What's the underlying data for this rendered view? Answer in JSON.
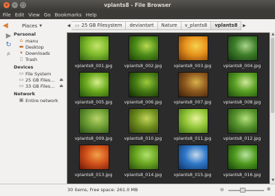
{
  "window": {
    "title": "vplants8 - File Browser",
    "close_icon": "×",
    "min_icon": "–",
    "max_icon": "□"
  },
  "menu": [
    "File",
    "Edit",
    "View",
    "Go",
    "Bookmarks",
    "Help"
  ],
  "places": {
    "label": "Places",
    "chevron": "▼"
  },
  "sidebar": {
    "personal": {
      "heading": "Personal",
      "items": [
        {
          "label": "manu",
          "icon": "home-icon"
        },
        {
          "label": "Desktop",
          "icon": "desktop-icon"
        },
        {
          "label": "Downloads",
          "icon": "downloads-icon"
        },
        {
          "label": "Trash",
          "icon": "trash-icon"
        }
      ]
    },
    "devices": {
      "heading": "Devices",
      "items": [
        {
          "label": "File System",
          "icon": "drive-icon"
        },
        {
          "label": "25 GB Files...",
          "icon": "drive-icon",
          "eject": "⏏"
        },
        {
          "label": "33 GB Files...",
          "icon": "drive-icon",
          "eject": "⏏"
        }
      ]
    },
    "network": {
      "heading": "Network",
      "items": [
        {
          "label": "Entire network",
          "icon": "network-icon"
        }
      ]
    }
  },
  "breadcrumb": {
    "left_arrow": "◀",
    "right_arrow": "▶",
    "items": [
      "25 GB Filesystem",
      "deviantart",
      "Nature",
      "v_plants8",
      "vplants8"
    ]
  },
  "files": [
    {
      "name": "vplants8_001.jpg",
      "colors": [
        "#2f5a12",
        "#7dba2a",
        "#c3e46a"
      ]
    },
    {
      "name": "vplants8_002.jpg",
      "colors": [
        "#1b3d08",
        "#4e8d19",
        "#b9d94f"
      ]
    },
    {
      "name": "vplants8_003.jpg",
      "colors": [
        "#7a3a06",
        "#e6931d",
        "#f6d24e"
      ]
    },
    {
      "name": "vplants8_004.jpg",
      "colors": [
        "#143a10",
        "#3f7f2a",
        "#a9d48c"
      ]
    },
    {
      "name": "vplants8_005.jpg",
      "colors": [
        "#25500c",
        "#6cab1e",
        "#d6ef8c"
      ]
    },
    {
      "name": "vplants8_006.jpg",
      "colors": [
        "#0e2a05",
        "#467c14",
        "#9cc93c"
      ]
    },
    {
      "name": "vplants8_007.jpg",
      "colors": [
        "#3a1d08",
        "#8f5a1f",
        "#d7b14a"
      ]
    },
    {
      "name": "vplants8_008.jpg",
      "colors": [
        "#1d4a0a",
        "#5aa024",
        "#cfe99a"
      ]
    },
    {
      "name": "vplants8_009.jpg",
      "colors": [
        "#2a4d13",
        "#6e9e34",
        "#b7d46a"
      ]
    },
    {
      "name": "vplants8_010.jpg",
      "colors": [
        "#2e3f10",
        "#6f8e1d",
        "#c2d35b"
      ]
    },
    {
      "name": "vplants8_011.jpg",
      "colors": [
        "#3d6d12",
        "#93c637",
        "#e6f39c"
      ]
    },
    {
      "name": "vplants8_012.jpg",
      "colors": [
        "#1f430f",
        "#57942d",
        "#b4df7c"
      ]
    },
    {
      "name": "vplants8_013.jpg",
      "colors": [
        "#6b1705",
        "#d2521a",
        "#f3a04a"
      ]
    },
    {
      "name": "vplants8_014.jpg",
      "colors": [
        "#244a0c",
        "#6aa621",
        "#aee26b"
      ]
    },
    {
      "name": "vplants8_015.jpg",
      "colors": [
        "#0f3468",
        "#2f78c8",
        "#c6d9ea"
      ]
    },
    {
      "name": "vplants8_016.jpg",
      "colors": [
        "#16420a",
        "#4f9a1e",
        "#b8e4a0"
      ]
    }
  ],
  "scrollbar": {
    "up_arrow": "▲",
    "down_arrow": "▼"
  },
  "status": {
    "text": "30 items, Free space: 261.0 MB",
    "zoom_out_icon": "⊖",
    "zoom_in_icon": "⊕"
  },
  "colors": {
    "accent_orange": "#f0703a",
    "titlebar_dark": "#3c3b37",
    "content_bg": "#2b2b2b"
  }
}
